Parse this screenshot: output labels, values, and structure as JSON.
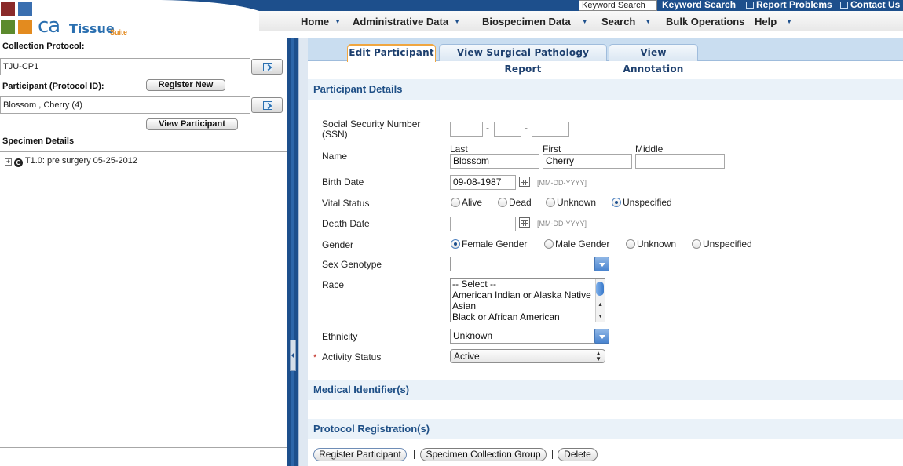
{
  "app": {
    "logo_text_ca": "ca",
    "logo_text_tissue": "Tissue",
    "logo_text_suite": "Suite"
  },
  "topbar": {
    "keyword_input_value": "Keyword Search",
    "keyword_search_link": "Keyword Search",
    "report_problems_link": "Report Problems",
    "contact_us_link": "Contact Us"
  },
  "menu": {
    "items": [
      {
        "label": "Home"
      },
      {
        "label": "Administrative Data"
      },
      {
        "label": "Biospecimen Data"
      },
      {
        "label": "Search"
      },
      {
        "label": "Bulk Operations"
      },
      {
        "label": "Help"
      }
    ]
  },
  "left": {
    "collection_protocol_label": "Collection Protocol:",
    "collection_protocol_value": "TJU-CP1",
    "participant_label": "Participant (Protocol ID):",
    "register_new_button": "Register New",
    "participant_value": "Blossom , Cherry (4)",
    "view_participant_button": "View Participant",
    "specimen_details_label": "Specimen Details",
    "tree_node_plus": "+",
    "tree_node_status": "C",
    "tree_node_label": "T1.0: pre surgery 05-25-2012"
  },
  "tabs": [
    {
      "label": "Edit Participant",
      "active": true
    },
    {
      "label": "View Surgical Pathology Report",
      "active": false
    },
    {
      "label": "View Annotation",
      "active": false
    }
  ],
  "sections": {
    "participant_details": "Participant Details",
    "medical_identifiers": "Medical Identifier(s)",
    "protocol_registrations": "Protocol Registration(s)"
  },
  "form": {
    "ssn_label_line1": "Social Security Number",
    "ssn_label_line2": "(SSN)",
    "ssn_sep": "-",
    "name_label": "Name",
    "last_label": "Last",
    "first_label": "First",
    "middle_label": "Middle",
    "last_value": "Blossom",
    "first_value": "Cherry",
    "middle_value": "",
    "birth_date_label": "Birth Date",
    "birth_date_value": "09-08-1987",
    "date_format_hint": "[MM-DD-YYYY]",
    "vital_status_label": "Vital Status",
    "vital_status_options": [
      "Alive",
      "Dead",
      "Unknown",
      "Unspecified"
    ],
    "vital_status_selected": "Unspecified",
    "death_date_label": "Death Date",
    "death_date_value": "",
    "gender_label": "Gender",
    "gender_options": [
      "Female Gender",
      "Male Gender",
      "Unknown",
      "Unspecified"
    ],
    "gender_selected": "Female Gender",
    "sex_genotype_label": "Sex Genotype",
    "sex_genotype_value": "",
    "race_label": "Race",
    "race_options": [
      "-- Select --",
      "American Indian or Alaska Native",
      "Asian",
      "Black or African American"
    ],
    "ethnicity_label": "Ethnicity",
    "ethnicity_value": "Unknown",
    "activity_status_required_mark": "*",
    "activity_status_label": "Activity Status",
    "activity_status_value": "Active"
  },
  "actions": {
    "register_participant_button": "Register Participant",
    "specimen_collection_group_button": "Specimen Collection Group",
    "delete_button": "Delete",
    "separator": "|"
  },
  "colors": {
    "brand_blue": "#1d4f8c",
    "section_header_text": "#1e4f86",
    "active_tab_accent": "#f0a640",
    "required_mark": "#c0281d"
  }
}
